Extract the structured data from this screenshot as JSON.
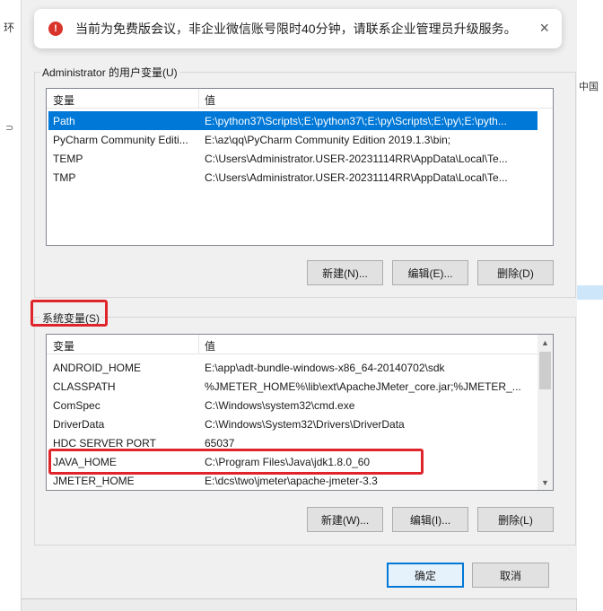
{
  "background": {
    "left_fragment": "环",
    "left_fragment2": "⊃",
    "right_fragment": "中国"
  },
  "banner": {
    "icon": "warning-icon",
    "message": "当前为免费版会议，非企业微信账号限时40分钟，请联系企业管理员升级服务。",
    "close": "×"
  },
  "user_vars": {
    "group_title": "Administrator 的用户变量(U)",
    "col_var": "变量",
    "col_val": "值",
    "rows": [
      {
        "name": "Path",
        "value": "E:\\python37\\Scripts\\;E:\\python37\\;E:\\py\\Scripts\\;E:\\py\\;E:\\pyth..."
      },
      {
        "name": "PyCharm Community Editi...",
        "value": "E:\\az\\qq\\PyCharm Community Edition 2019.1.3\\bin;"
      },
      {
        "name": "TEMP",
        "value": "C:\\Users\\Administrator.USER-20231114RR\\AppData\\Local\\Te..."
      },
      {
        "name": "TMP",
        "value": "C:\\Users\\Administrator.USER-20231114RR\\AppData\\Local\\Te..."
      }
    ],
    "selected_index": 0,
    "btn_new": "新建(N)...",
    "btn_edit": "编辑(E)...",
    "btn_delete": "删除(D)"
  },
  "sys_vars": {
    "group_title": "系统变量(S)",
    "col_var": "变量",
    "col_val": "值",
    "rows": [
      {
        "name": "ANDROID_HOME",
        "value": "E:\\app\\adt-bundle-windows-x86_64-20140702\\sdk"
      },
      {
        "name": "CLASSPATH",
        "value": "%JMETER_HOME%\\lib\\ext\\ApacheJMeter_core.jar;%JMETER_..."
      },
      {
        "name": "ComSpec",
        "value": "C:\\Windows\\system32\\cmd.exe"
      },
      {
        "name": "DriverData",
        "value": "C:\\Windows\\System32\\Drivers\\DriverData"
      },
      {
        "name": "HDC SERVER PORT",
        "value": "65037"
      },
      {
        "name": "JAVA_HOME",
        "value": "C:\\Program Files\\Java\\jdk1.8.0_60"
      },
      {
        "name": "JMETER_HOME",
        "value": "E:\\dcs\\two\\jmeter\\apache-jmeter-3.3"
      }
    ],
    "btn_new": "新建(W)...",
    "btn_edit": "编辑(I)...",
    "btn_delete": "删除(L)"
  },
  "footer": {
    "ok": "确定",
    "cancel": "取消"
  },
  "colors": {
    "selection": "#0078d7",
    "highlight_box": "#e0242b",
    "warning": "#d9342b"
  }
}
